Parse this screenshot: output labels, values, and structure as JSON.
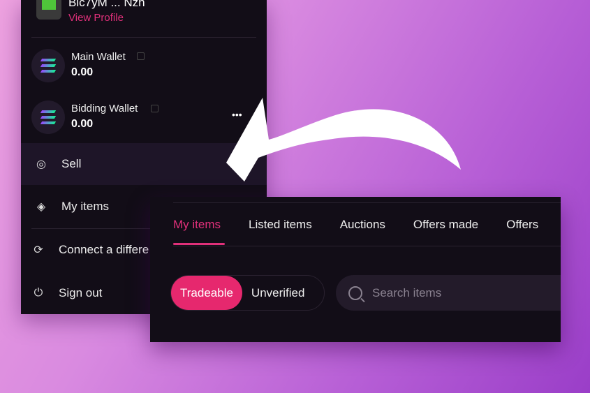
{
  "profile": {
    "name": "Bic7yM ... Nzh",
    "view_profile": "View Profile"
  },
  "wallets": [
    {
      "name": "Main Wallet",
      "balance": "0.00"
    },
    {
      "name": "Bidding Wallet",
      "balance": "0.00"
    }
  ],
  "more_label": "•••",
  "menu": [
    {
      "label": "Sell",
      "icon": "coins-icon"
    },
    {
      "label": "My items",
      "icon": "layers-icon"
    },
    {
      "label": "Connect a differe",
      "icon": "refresh-icon"
    },
    {
      "label": "Sign out",
      "icon": "power-icon"
    }
  ],
  "tabs": [
    "My items",
    "Listed items",
    "Auctions",
    "Offers made",
    "Offers"
  ],
  "active_tab": "My items",
  "filters": {
    "tradeable": "Tradeable",
    "unverified": "Unverified",
    "selected": "Tradeable"
  },
  "search": {
    "placeholder": "Search items"
  },
  "colors": {
    "accent": "#e0307a",
    "panel": "#120d17"
  }
}
